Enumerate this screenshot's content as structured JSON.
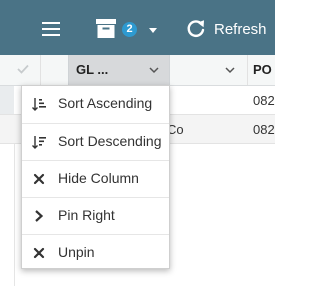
{
  "toolbar": {
    "archive_count": "2",
    "refresh_label": "Refresh"
  },
  "grid": {
    "columns": [
      {
        "label": "GL ..."
      },
      {
        "label": ""
      },
      {
        "label": "PO"
      }
    ],
    "rows": [
      {
        "vendor": "",
        "po": "082"
      },
      {
        "vendor": "Co",
        "po": "082"
      }
    ]
  },
  "column_menu": {
    "items": [
      {
        "label": "Sort Ascending",
        "icon": "sort-ascending-icon"
      },
      {
        "label": "Sort Descending",
        "icon": "sort-descending-icon"
      },
      {
        "label": "Hide Column",
        "icon": "close-icon"
      },
      {
        "label": "Pin Right",
        "icon": "chevron-right-icon"
      },
      {
        "label": "Unpin",
        "icon": "close-icon"
      }
    ]
  },
  "colors": {
    "toolbar_bg": "#4a7386",
    "badge_bg": "#2e9ad0",
    "active_header_bg": "#d7d9db"
  }
}
